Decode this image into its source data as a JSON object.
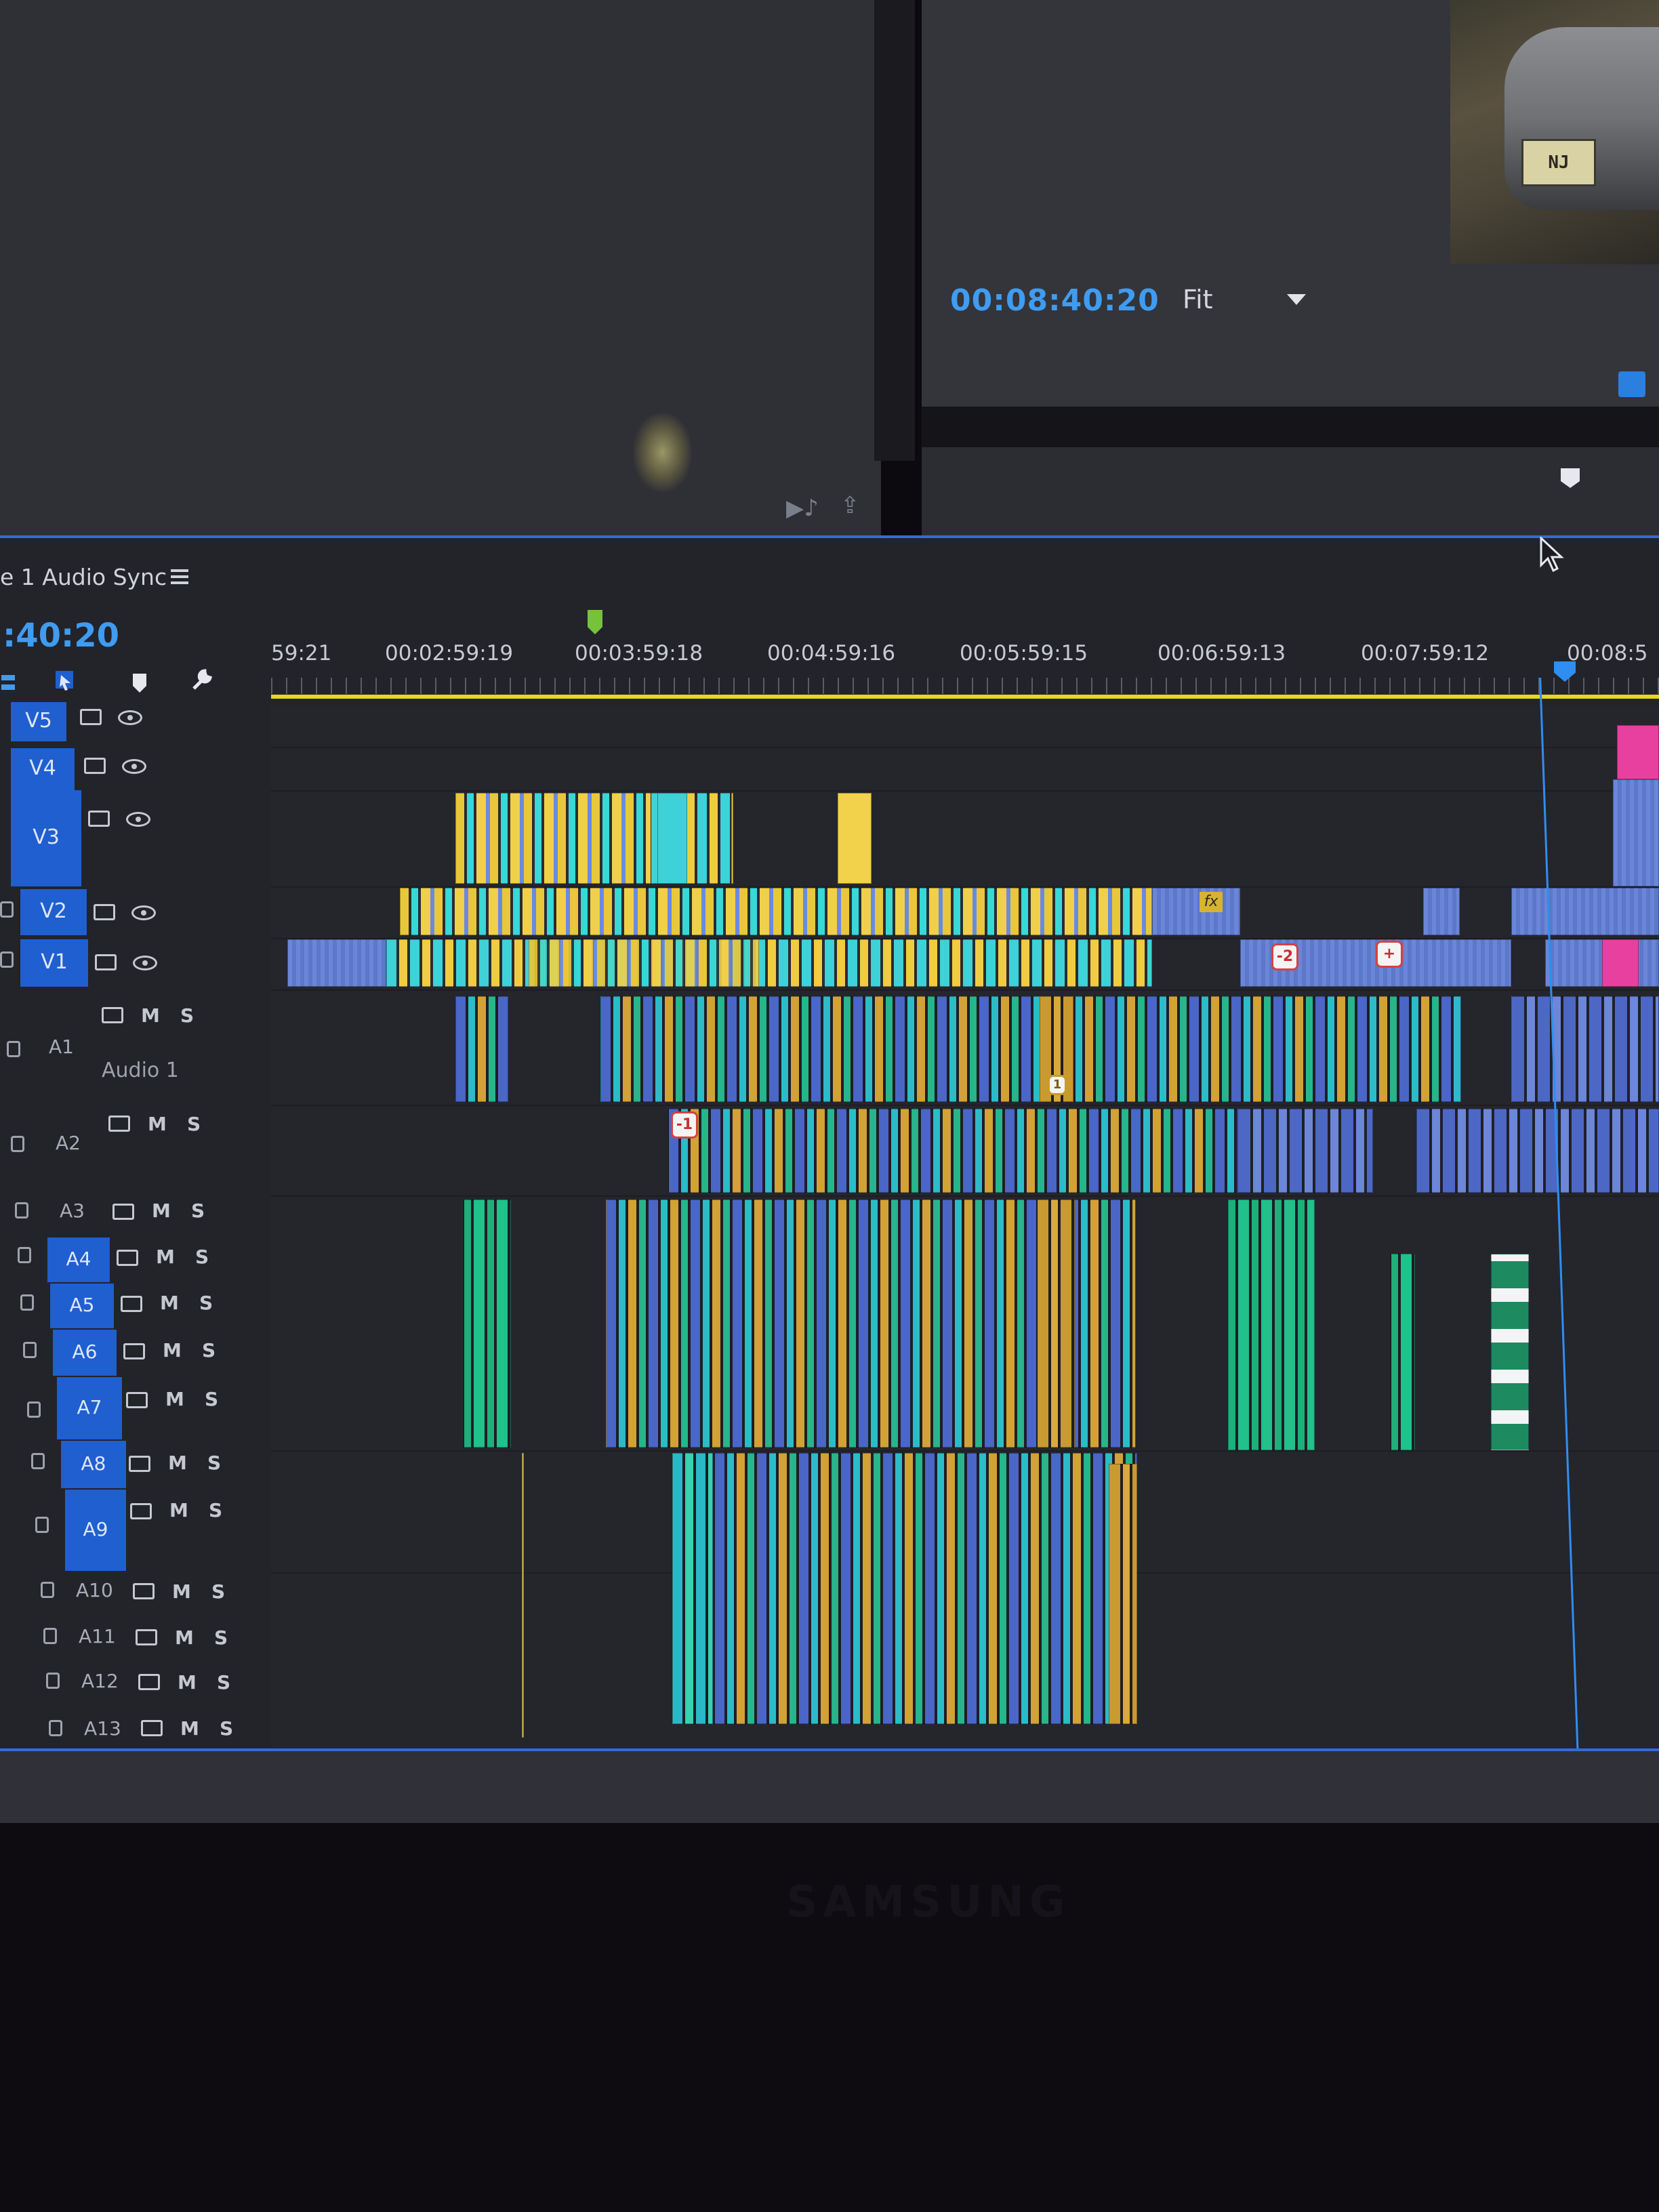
{
  "program_monitor": {
    "timecode": "00:08:40:20",
    "fit_label": "Fit",
    "plate_text": "NJ"
  },
  "timeline": {
    "sequence_tab": "e 1 Audio Sync",
    "timecode": ":40:20",
    "ruler_labels": [
      "59:21",
      "00:02:59:19",
      "00:03:59:18",
      "00:04:59:16",
      "00:05:59:15",
      "00:06:59:13",
      "00:07:59:12",
      "00:08:5"
    ],
    "video_tracks": [
      {
        "name": "V5"
      },
      {
        "name": "V4"
      },
      {
        "name": "V3"
      },
      {
        "name": "V2"
      },
      {
        "name": "V1"
      }
    ],
    "audio_tracks": [
      {
        "name": "A1",
        "label": "Audio 1"
      },
      {
        "name": "A2"
      },
      {
        "name": "A3"
      },
      {
        "name": "A4"
      },
      {
        "name": "A5"
      },
      {
        "name": "A6"
      },
      {
        "name": "A7"
      },
      {
        "name": "A8"
      },
      {
        "name": "A9"
      },
      {
        "name": "A10"
      },
      {
        "name": "A11"
      },
      {
        "name": "A12"
      },
      {
        "name": "A13"
      }
    ],
    "mute_label": "M",
    "solo_label": "S",
    "fx_label": "fx",
    "badges": [
      "-1",
      "-2",
      "+",
      "1"
    ]
  },
  "monitor_brand": "SAMSUNG",
  "colors": {
    "accent": "#2f8ef0",
    "track_toggle": "#1f5fd0",
    "ruler_yellow": "#e4d820",
    "clip_yellow": "#e8c83a",
    "clip_cyan": "#38d8d6",
    "clip_blue": "#6b86d8",
    "clip_gold": "#c89a30",
    "clip_green": "#1db07a",
    "clip_pink": "#e8409e"
  }
}
